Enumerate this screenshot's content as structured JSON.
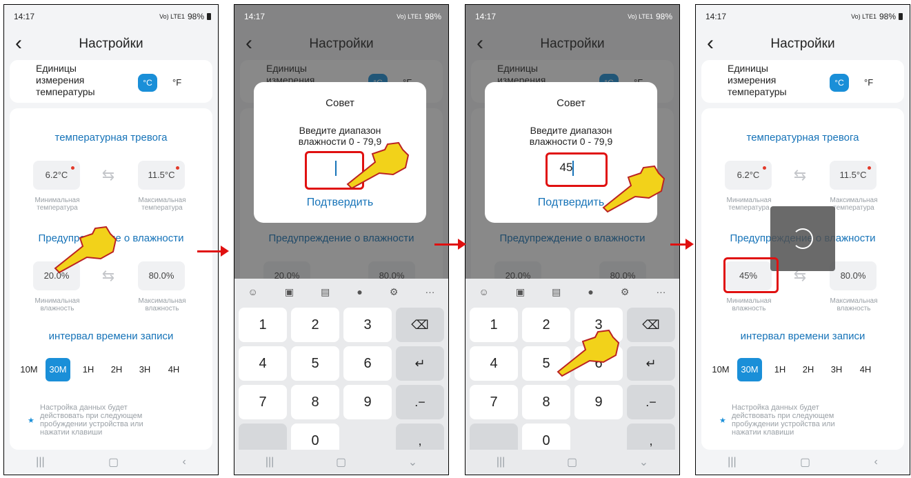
{
  "status": {
    "time": "14:17",
    "signal": "Vo) LTE1",
    "battery": "98%"
  },
  "header": {
    "title": "Настройки",
    "back_icon": "chevron-left-icon"
  },
  "units": {
    "label": "Единицы измерения температуры",
    "celsius": "°C",
    "fahrenheit": "°F"
  },
  "temp_alarm": {
    "title": "температурная тревога",
    "min_value": "6.2°C",
    "max_value": "11.5°C",
    "min_caption": "Минимальная температура",
    "max_caption": "Максимальная температура"
  },
  "humidity_alarm": {
    "title": "Предупреждение о влажности",
    "min_value": "20.0%",
    "max_value": "80.0%",
    "min_value_after": "45%",
    "min_caption": "Минимальная влажность",
    "max_caption": "Максимальная влажность"
  },
  "interval": {
    "title": "интервал времени записи",
    "options": [
      "10M",
      "30M",
      "1H",
      "2H",
      "3H",
      "4H"
    ],
    "selected": "30M"
  },
  "note": "Настройка данных будет действовать при следующем пробуждении устройства или нажатии клавиши",
  "dialog": {
    "title": "Совет",
    "message_line1": "Введите диапазон",
    "message_line2": "влажности 0 - 79,9",
    "message_line2_cut": "влажности 0 - 79,9",
    "input_entered": "45",
    "confirm": "Подтвердить"
  },
  "keyboard": {
    "keys": [
      "1",
      "2",
      "3",
      "4",
      "5",
      "6",
      "7",
      "8",
      "9",
      "0"
    ],
    "backspace": "⌫",
    "enter": "↵",
    "dot_dash": ".−",
    "comma": ","
  },
  "colors": {
    "accent": "#1a8fd8",
    "link": "#1673b8",
    "highlight": "#e01010"
  }
}
